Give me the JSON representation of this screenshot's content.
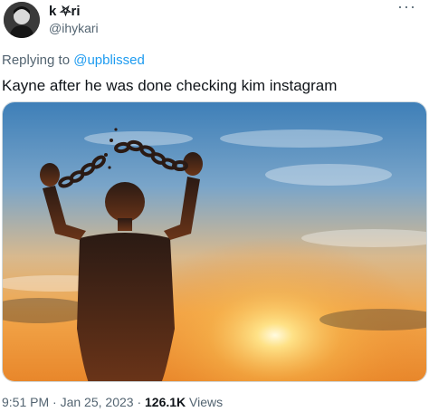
{
  "author": {
    "display_name": "k ⛧ri",
    "handle": "@ihykari"
  },
  "menu": {
    "more_glyph": "···"
  },
  "reply": {
    "prefix": "Replying to ",
    "mention": "@upblissed"
  },
  "tweet": {
    "text": "Kayne after he was done checking kim instagram"
  },
  "footer": {
    "time": "9:51 PM",
    "separator_1": " · ",
    "date": "Jan 25, 2023",
    "separator_2": " · ",
    "views_count": "126.1K",
    "views_label": " Views"
  },
  "colors": {
    "text_primary": "#0f1419",
    "text_secondary": "#536471",
    "link": "#1d9bf0"
  }
}
